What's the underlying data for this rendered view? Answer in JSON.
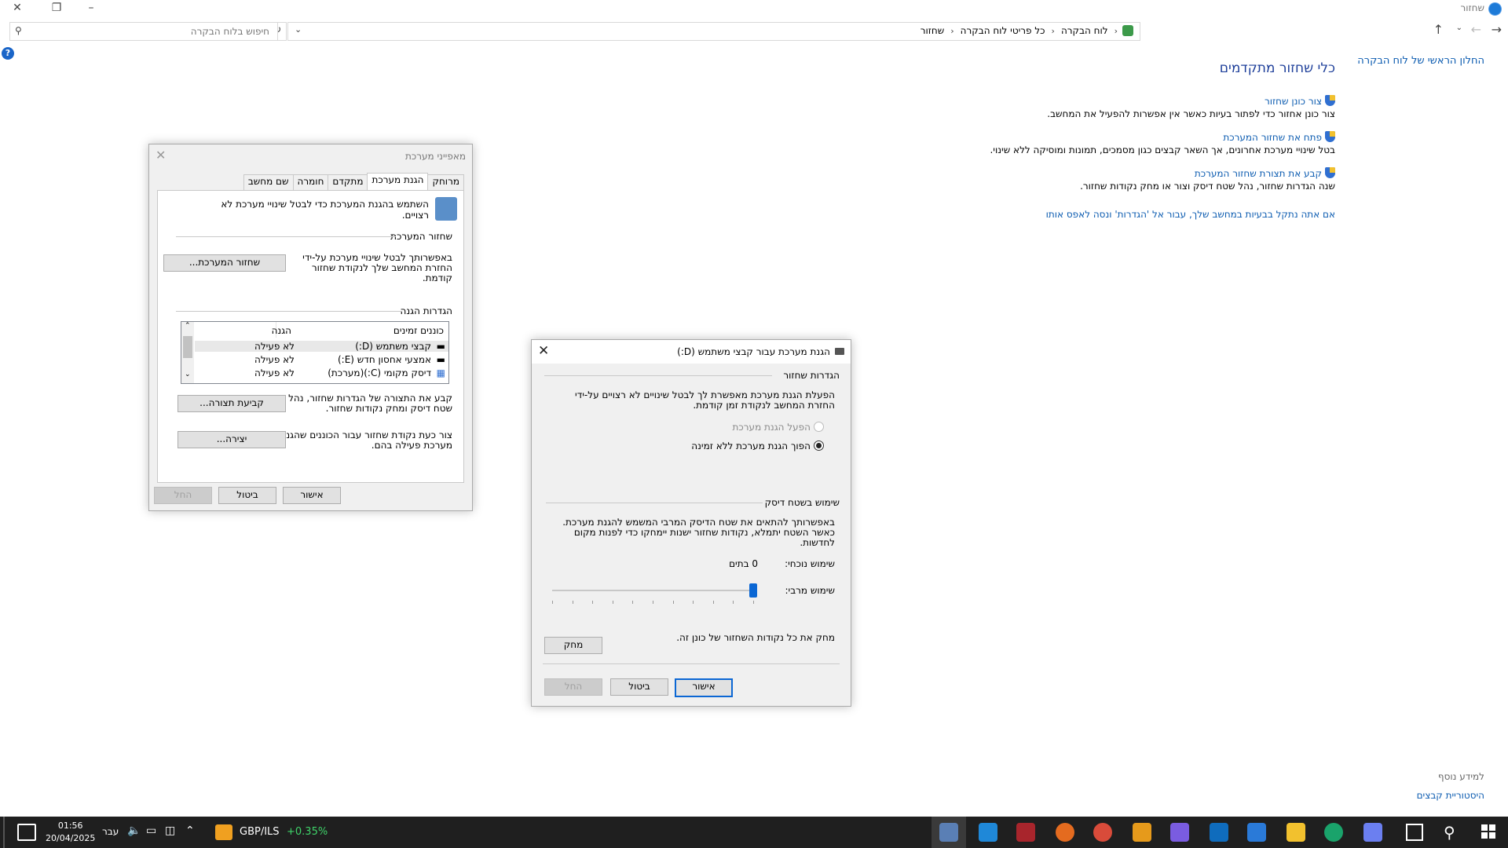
{
  "window": {
    "title": "שחזור"
  },
  "address": {
    "crumbs": [
      "לוח הבקרה",
      "כל פריטי לוח הבקרה",
      "שחזור"
    ],
    "search_placeholder": "חיפוש בלוח הבקרה"
  },
  "sidebar": {
    "home_link": "החלון הראשי של לוח הבקרה",
    "see_also": "למידע נוסף",
    "file_history": "היסטוריית קבצים"
  },
  "main": {
    "title": "כלי שחזור מתקדמים",
    "tools": [
      {
        "link": "צור כונן שחזור",
        "desc": "צור כונן אחזור כדי לפתור בעיות כאשר אין אפשרות להפעיל את המחשב."
      },
      {
        "link": "פתח את שחזור המערכת",
        "desc": "בטל שינויי מערכת אחרונים, אך השאר קבצים כגון מסמכים, תמונות ומוסיקה ללא שינוי."
      },
      {
        "link": "קבע את תצורת שחזור המערכת",
        "desc": "שנה הגדרות שחזור, נהל שטח דיסק וצור או מחק נקודות שחזור."
      }
    ],
    "reset_link": "אם אתה נתקל בבעיות במחשב שלך, עבור אל 'הגדרות' ונסה לאפס אותו"
  },
  "sysprops": {
    "title": "מאפייני מערכת",
    "tabs": [
      "שם מחשב",
      "חומרה",
      "מתקדם",
      "הגנת מערכת",
      "מרוחק"
    ],
    "intro": "השתמש בהגנת המערכת כדי לבטל שינויי מערכת לא רצויים.",
    "restore_group": "שחזור המערכת",
    "restore_text": "באפשרותך לבטל שינויי מערכת על-ידי החזרת המחשב שלך לנקודת שחזור קודמת.",
    "restore_button": "שחזור המערכת...",
    "protection_group": "הגדרות הגנה",
    "col_drives": "כוננים זמינים",
    "col_protection": "הגנה",
    "drives": [
      {
        "name": "קבצי משתמש (D:)",
        "status": "לא פעילה"
      },
      {
        "name": "אמצעי אחסון חדש (E:)",
        "status": "לא פעילה"
      },
      {
        "name": "דיסק מקומי (C:)(מערכת)",
        "status": "לא פעילה"
      }
    ],
    "configure_text": "קבע את התצורה של הגדרות שחזור, נהל שטח דיסק ומחק נקודות שחזור.",
    "configure_button": "קביעת תצורה...",
    "create_text": "צור כעת נקודת שחזור עבור הכוננים שהגנת מערכת פעילה בהם.",
    "create_button": "יצירה...",
    "ok": "אישור",
    "cancel": "ביטול",
    "apply": "החל"
  },
  "protd": {
    "title": "הגנת מערכת עבור קבצי משתמש (D:)",
    "restore_settings": "הגדרות שחזור",
    "restore_desc": "הפעלת הגנת מערכת מאפשרת לך לבטל שינויים לא רצויים על-ידי החזרת המחשב לנקודת זמן קודמת.",
    "radio_on": "הפעל הגנת מערכת",
    "radio_off": "הפוך הגנת מערכת ללא זמינה",
    "disk_usage": "שימוש בשטח דיסק",
    "disk_desc": "באפשרותך להתאים את שטח הדיסק המרבי המשמש להגנת מערכת. כאשר השטח יתמלא, נקודות שחזור ישנות יימחקו כדי לפנות מקום לחדשות.",
    "current_label": "שימוש נוכחי:",
    "current_value": "0 בתים",
    "max_label": "שימוש מרבי:",
    "max_usage_fraction": 1.0,
    "delete_text": "מחק את כל נקודות השחזור של כונן זה.",
    "delete_button": "מחק",
    "ok": "אישור",
    "cancel": "ביטול",
    "apply": "החל"
  },
  "taskbar": {
    "time": "01:56",
    "date": "20/04/2025",
    "language": "עבר",
    "ticker": "GBP/ILS",
    "ticker_change": "+0.35%",
    "ticker_change_color": "#3fd46a"
  }
}
